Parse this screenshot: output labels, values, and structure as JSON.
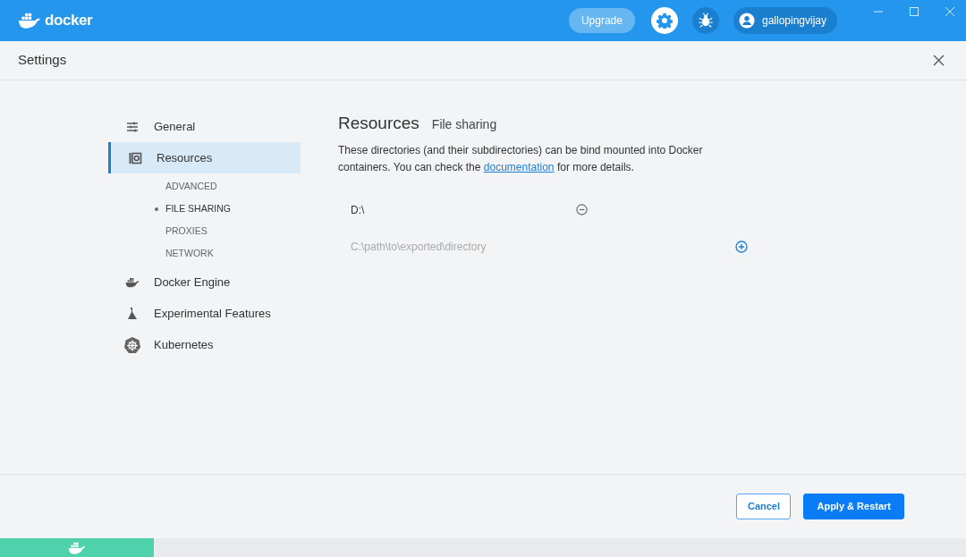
{
  "titlebar": {
    "logo_text": "docker",
    "upgrade_button": "Upgrade",
    "username": "gallopingvijay"
  },
  "header": {
    "title": "Settings"
  },
  "sidebar": {
    "items": [
      {
        "label": "General",
        "kind": "sliders",
        "selected": false
      },
      {
        "label": "Resources",
        "kind": "resources",
        "selected": true,
        "children": [
          {
            "label": "ADVANCED",
            "selected": false
          },
          {
            "label": "FILE SHARING",
            "selected": true
          },
          {
            "label": "PROXIES",
            "selected": false
          },
          {
            "label": "NETWORK",
            "selected": false
          }
        ]
      },
      {
        "label": "Docker Engine",
        "kind": "whale",
        "selected": false
      },
      {
        "label": "Experimental Features",
        "kind": "flask",
        "selected": false
      },
      {
        "label": "Kubernetes",
        "kind": "helm",
        "selected": false
      }
    ]
  },
  "content": {
    "title": "Resources",
    "subtitle": "File sharing",
    "description": {
      "before": "These directories (and their subdirectories) can be bind mounted into Docker containers. You can check the",
      "link": "documentation",
      "after": "for more details."
    },
    "shared_directories": [
      "D:\\"
    ],
    "new_directory": {
      "placeholder": "C:\\path\\to\\exported\\directory"
    }
  },
  "footer": {
    "buttons": [
      {
        "label": "Cancel",
        "kind": "secondary"
      },
      {
        "label": "Apply & Restart",
        "kind": "primary"
      }
    ]
  }
}
